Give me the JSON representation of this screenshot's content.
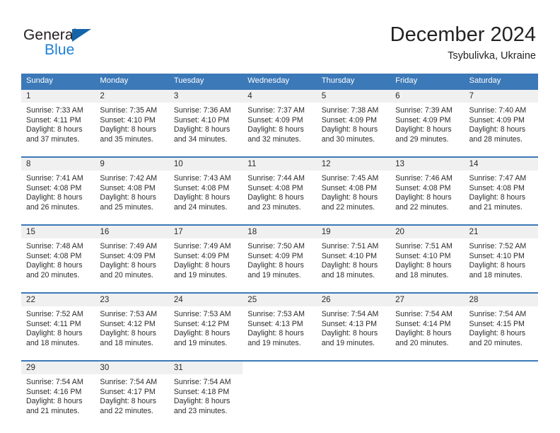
{
  "logo": {
    "word_top": "General",
    "word_bottom": "Blue",
    "triangle_color": "#1464aa",
    "blue_text_color": "#1e7fd4"
  },
  "header": {
    "title": "December 2024",
    "subtitle": "Tsybulivka, Ukraine"
  },
  "theme": {
    "header_bg": "#3c79b8",
    "header_text": "#ffffff",
    "daynum_bg": "#f0f0f0",
    "row_border": "#3c79b8"
  },
  "weekdays": [
    "Sunday",
    "Monday",
    "Tuesday",
    "Wednesday",
    "Thursday",
    "Friday",
    "Saturday"
  ],
  "weeks": [
    {
      "days": [
        {
          "num": "1",
          "sunrise": "Sunrise: 7:33 AM",
          "sunset": "Sunset: 4:11 PM",
          "daylight1": "Daylight: 8 hours",
          "daylight2": "and 37 minutes."
        },
        {
          "num": "2",
          "sunrise": "Sunrise: 7:35 AM",
          "sunset": "Sunset: 4:10 PM",
          "daylight1": "Daylight: 8 hours",
          "daylight2": "and 35 minutes."
        },
        {
          "num": "3",
          "sunrise": "Sunrise: 7:36 AM",
          "sunset": "Sunset: 4:10 PM",
          "daylight1": "Daylight: 8 hours",
          "daylight2": "and 34 minutes."
        },
        {
          "num": "4",
          "sunrise": "Sunrise: 7:37 AM",
          "sunset": "Sunset: 4:09 PM",
          "daylight1": "Daylight: 8 hours",
          "daylight2": "and 32 minutes."
        },
        {
          "num": "5",
          "sunrise": "Sunrise: 7:38 AM",
          "sunset": "Sunset: 4:09 PM",
          "daylight1": "Daylight: 8 hours",
          "daylight2": "and 30 minutes."
        },
        {
          "num": "6",
          "sunrise": "Sunrise: 7:39 AM",
          "sunset": "Sunset: 4:09 PM",
          "daylight1": "Daylight: 8 hours",
          "daylight2": "and 29 minutes."
        },
        {
          "num": "7",
          "sunrise": "Sunrise: 7:40 AM",
          "sunset": "Sunset: 4:09 PM",
          "daylight1": "Daylight: 8 hours",
          "daylight2": "and 28 minutes."
        }
      ]
    },
    {
      "days": [
        {
          "num": "8",
          "sunrise": "Sunrise: 7:41 AM",
          "sunset": "Sunset: 4:08 PM",
          "daylight1": "Daylight: 8 hours",
          "daylight2": "and 26 minutes."
        },
        {
          "num": "9",
          "sunrise": "Sunrise: 7:42 AM",
          "sunset": "Sunset: 4:08 PM",
          "daylight1": "Daylight: 8 hours",
          "daylight2": "and 25 minutes."
        },
        {
          "num": "10",
          "sunrise": "Sunrise: 7:43 AM",
          "sunset": "Sunset: 4:08 PM",
          "daylight1": "Daylight: 8 hours",
          "daylight2": "and 24 minutes."
        },
        {
          "num": "11",
          "sunrise": "Sunrise: 7:44 AM",
          "sunset": "Sunset: 4:08 PM",
          "daylight1": "Daylight: 8 hours",
          "daylight2": "and 23 minutes."
        },
        {
          "num": "12",
          "sunrise": "Sunrise: 7:45 AM",
          "sunset": "Sunset: 4:08 PM",
          "daylight1": "Daylight: 8 hours",
          "daylight2": "and 22 minutes."
        },
        {
          "num": "13",
          "sunrise": "Sunrise: 7:46 AM",
          "sunset": "Sunset: 4:08 PM",
          "daylight1": "Daylight: 8 hours",
          "daylight2": "and 22 minutes."
        },
        {
          "num": "14",
          "sunrise": "Sunrise: 7:47 AM",
          "sunset": "Sunset: 4:08 PM",
          "daylight1": "Daylight: 8 hours",
          "daylight2": "and 21 minutes."
        }
      ]
    },
    {
      "days": [
        {
          "num": "15",
          "sunrise": "Sunrise: 7:48 AM",
          "sunset": "Sunset: 4:08 PM",
          "daylight1": "Daylight: 8 hours",
          "daylight2": "and 20 minutes."
        },
        {
          "num": "16",
          "sunrise": "Sunrise: 7:49 AM",
          "sunset": "Sunset: 4:09 PM",
          "daylight1": "Daylight: 8 hours",
          "daylight2": "and 20 minutes."
        },
        {
          "num": "17",
          "sunrise": "Sunrise: 7:49 AM",
          "sunset": "Sunset: 4:09 PM",
          "daylight1": "Daylight: 8 hours",
          "daylight2": "and 19 minutes."
        },
        {
          "num": "18",
          "sunrise": "Sunrise: 7:50 AM",
          "sunset": "Sunset: 4:09 PM",
          "daylight1": "Daylight: 8 hours",
          "daylight2": "and 19 minutes."
        },
        {
          "num": "19",
          "sunrise": "Sunrise: 7:51 AM",
          "sunset": "Sunset: 4:10 PM",
          "daylight1": "Daylight: 8 hours",
          "daylight2": "and 18 minutes."
        },
        {
          "num": "20",
          "sunrise": "Sunrise: 7:51 AM",
          "sunset": "Sunset: 4:10 PM",
          "daylight1": "Daylight: 8 hours",
          "daylight2": "and 18 minutes."
        },
        {
          "num": "21",
          "sunrise": "Sunrise: 7:52 AM",
          "sunset": "Sunset: 4:10 PM",
          "daylight1": "Daylight: 8 hours",
          "daylight2": "and 18 minutes."
        }
      ]
    },
    {
      "days": [
        {
          "num": "22",
          "sunrise": "Sunrise: 7:52 AM",
          "sunset": "Sunset: 4:11 PM",
          "daylight1": "Daylight: 8 hours",
          "daylight2": "and 18 minutes."
        },
        {
          "num": "23",
          "sunrise": "Sunrise: 7:53 AM",
          "sunset": "Sunset: 4:12 PM",
          "daylight1": "Daylight: 8 hours",
          "daylight2": "and 18 minutes."
        },
        {
          "num": "24",
          "sunrise": "Sunrise: 7:53 AM",
          "sunset": "Sunset: 4:12 PM",
          "daylight1": "Daylight: 8 hours",
          "daylight2": "and 19 minutes."
        },
        {
          "num": "25",
          "sunrise": "Sunrise: 7:53 AM",
          "sunset": "Sunset: 4:13 PM",
          "daylight1": "Daylight: 8 hours",
          "daylight2": "and 19 minutes."
        },
        {
          "num": "26",
          "sunrise": "Sunrise: 7:54 AM",
          "sunset": "Sunset: 4:13 PM",
          "daylight1": "Daylight: 8 hours",
          "daylight2": "and 19 minutes."
        },
        {
          "num": "27",
          "sunrise": "Sunrise: 7:54 AM",
          "sunset": "Sunset: 4:14 PM",
          "daylight1": "Daylight: 8 hours",
          "daylight2": "and 20 minutes."
        },
        {
          "num": "28",
          "sunrise": "Sunrise: 7:54 AM",
          "sunset": "Sunset: 4:15 PM",
          "daylight1": "Daylight: 8 hours",
          "daylight2": "and 20 minutes."
        }
      ]
    },
    {
      "days": [
        {
          "num": "29",
          "sunrise": "Sunrise: 7:54 AM",
          "sunset": "Sunset: 4:16 PM",
          "daylight1": "Daylight: 8 hours",
          "daylight2": "and 21 minutes."
        },
        {
          "num": "30",
          "sunrise": "Sunrise: 7:54 AM",
          "sunset": "Sunset: 4:17 PM",
          "daylight1": "Daylight: 8 hours",
          "daylight2": "and 22 minutes."
        },
        {
          "num": "31",
          "sunrise": "Sunrise: 7:54 AM",
          "sunset": "Sunset: 4:18 PM",
          "daylight1": "Daylight: 8 hours",
          "daylight2": "and 23 minutes."
        },
        {
          "num": "",
          "sunrise": "",
          "sunset": "",
          "daylight1": "",
          "daylight2": ""
        },
        {
          "num": "",
          "sunrise": "",
          "sunset": "",
          "daylight1": "",
          "daylight2": ""
        },
        {
          "num": "",
          "sunrise": "",
          "sunset": "",
          "daylight1": "",
          "daylight2": ""
        },
        {
          "num": "",
          "sunrise": "",
          "sunset": "",
          "daylight1": "",
          "daylight2": ""
        }
      ]
    }
  ]
}
